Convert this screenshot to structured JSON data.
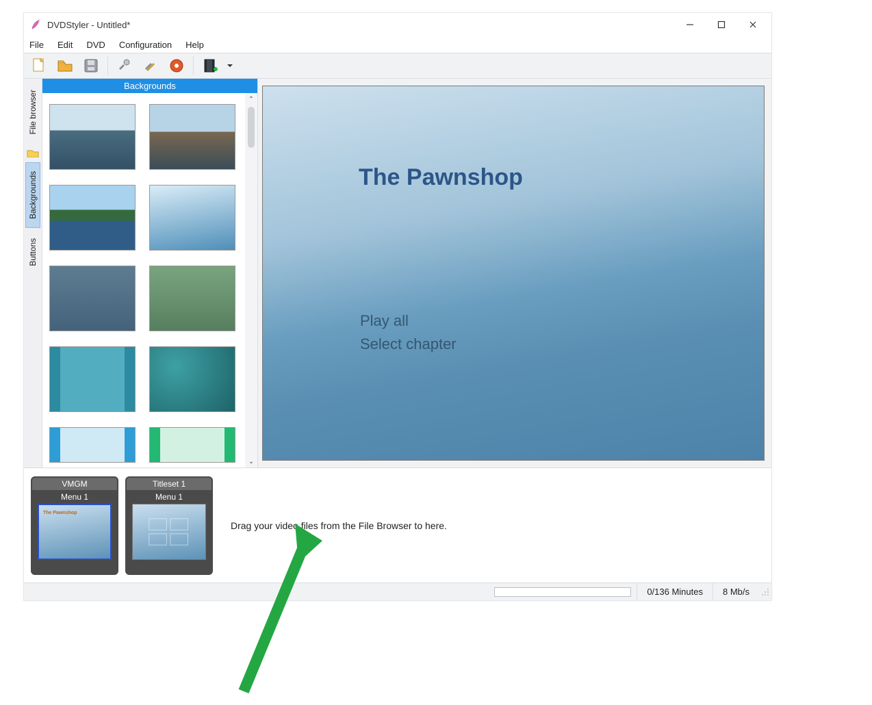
{
  "window": {
    "title": "DVDStyler - Untitled*"
  },
  "menu": {
    "file": "File",
    "edit": "Edit",
    "dvd": "DVD",
    "config": "Configuration",
    "help": "Help"
  },
  "sidebar": {
    "file_browser": "File browser",
    "backgrounds": "Backgrounds",
    "buttons": "Buttons"
  },
  "panel": {
    "header": "Backgrounds"
  },
  "preview": {
    "title": "The Pawnshop",
    "play_all": "Play all",
    "select_chapter": "Select chapter"
  },
  "timeline": {
    "items": [
      {
        "group": "VMGM",
        "label": "Menu 1",
        "thumb_title": "The Pawnshop"
      },
      {
        "group": "Titleset 1",
        "label": "Menu 1",
        "thumb_title": ""
      }
    ],
    "hint": "Drag your video files from the File Browser to here."
  },
  "status": {
    "minutes": "0/136 Minutes",
    "bitrate": "8 Mb/s"
  }
}
